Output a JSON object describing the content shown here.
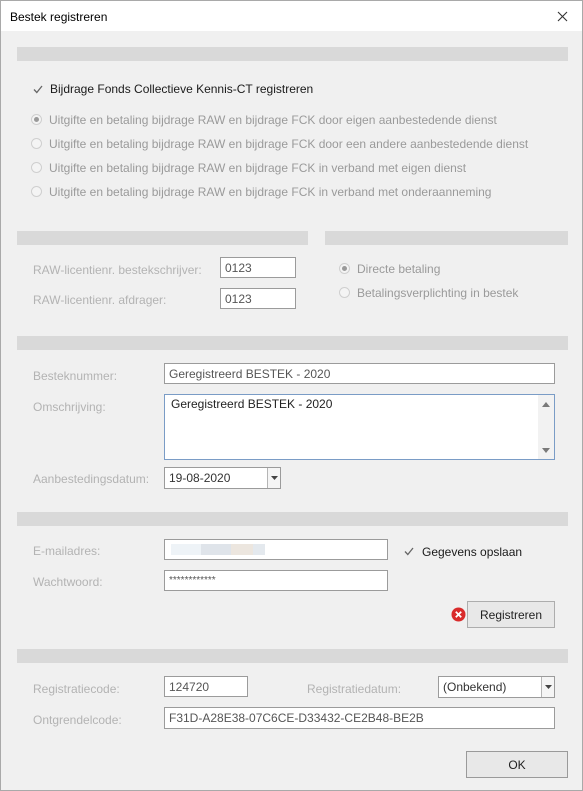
{
  "window": {
    "title": "Bestek registreren"
  },
  "fck": {
    "checkbox_label": "Bijdrage Fonds Collectieve Kennis-CT registreren",
    "options": [
      "Uitgifte en betaling bijdrage RAW en bijdrage FCK door eigen aanbestedende dienst",
      "Uitgifte en betaling bijdrage RAW en bijdrage FCK door een andere aanbestedende dienst",
      "Uitgifte en betaling bijdrage RAW en bijdrage FCK in verband met eigen dienst",
      "Uitgifte en betaling bijdrage RAW en bijdrage FCK in verband met onderaanneming"
    ]
  },
  "raw": {
    "bestekschrijver_label": "RAW-licentienr. bestekschrijver:",
    "bestekschrijver_value": "0123",
    "afdrager_label": "RAW-licentienr. afdrager:",
    "afdrager_value": "0123"
  },
  "betaling": {
    "options": [
      "Directe betaling",
      "Betalingsverplichting in bestek"
    ]
  },
  "bestek": {
    "nummer_label": "Besteknummer:",
    "nummer_value": "Geregistreerd BESTEK - 2020",
    "omschrijving_label": "Omschrijving:",
    "omschrijving_value": "Geregistreerd BESTEK - 2020",
    "datum_label": "Aanbestedingsdatum:",
    "datum_value": "19-08-2020"
  },
  "account": {
    "email_label": "E-mailadres:",
    "wachtwoord_label": "Wachtwoord:",
    "wachtwoord_value": "************",
    "opslaan_label": "Gegevens opslaan",
    "registreren_label": "Registreren"
  },
  "registratie": {
    "code_label": "Registratiecode:",
    "code_value": "124720",
    "datum_label": "Registratiedatum:",
    "datum_value": "(Onbekend)",
    "ontgrendel_label": "Ontgrendelcode:",
    "ontgrendel_value": "F31D-A28E38-07C6CE-D33432-CE2B48-BE2B"
  },
  "footer": {
    "ok_label": "OK"
  },
  "colors": {
    "error_icon": "#d92b2b",
    "section_bar": "#d9d9d9"
  },
  "icons": [
    "close-icon",
    "check-icon",
    "error-icon",
    "chevron-down-icon",
    "scroll-up-icon",
    "scroll-down-icon"
  ]
}
